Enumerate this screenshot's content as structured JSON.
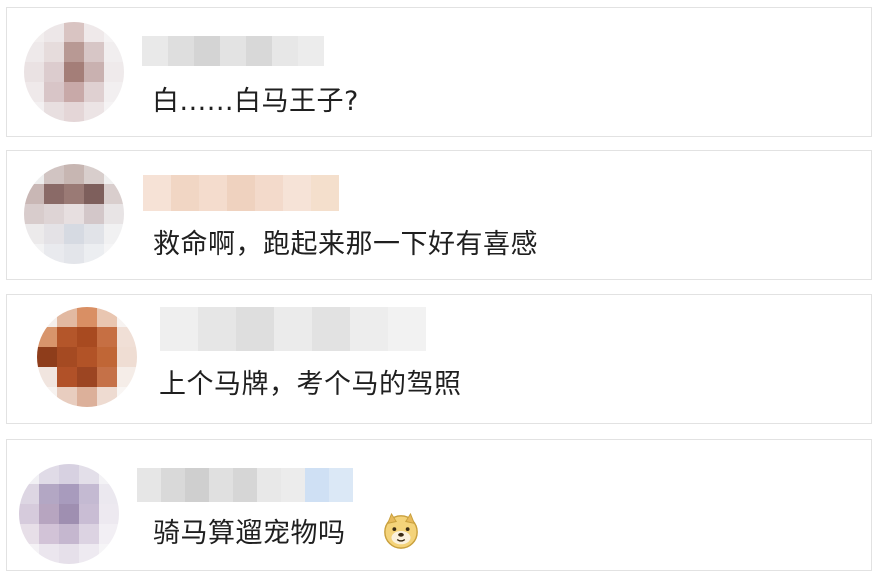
{
  "comments": [
    {
      "text": "白......白马王子?"
    },
    {
      "text": "救命啊，跑起来那一下好有喜感"
    },
    {
      "text": "上个马牌，考个马的驾照"
    },
    {
      "text": "骑马算遛宠物吗",
      "emoji": "doge-emoji"
    }
  ]
}
